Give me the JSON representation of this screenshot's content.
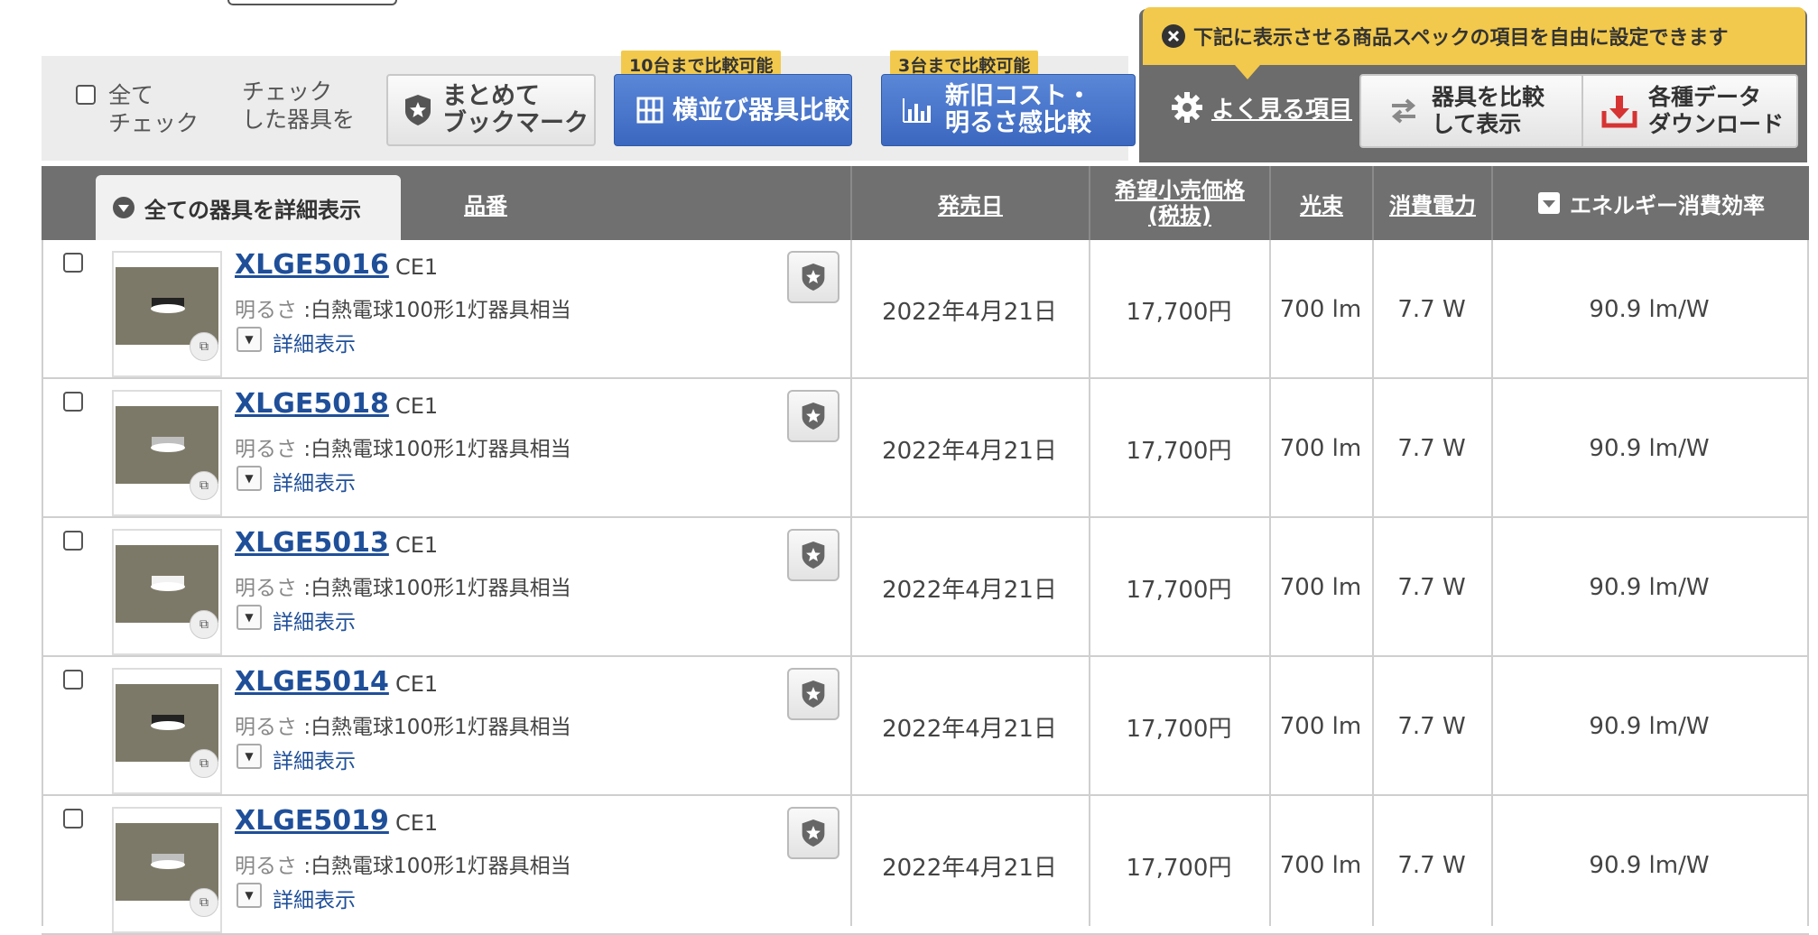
{
  "toolbar": {
    "check_all_label": "全て\nチェック",
    "checked_items_label": "チェック\nした器具を",
    "bookmark_all": "まとめて\nブックマーク",
    "compare_tag": "10台まで比較可能",
    "compare_side": "横並び器具比較",
    "cost_tag": "3台まで比較可能",
    "cost_compare": "新旧コスト・\n明るさ感比較"
  },
  "settings": {
    "banner_text": "下記に表示させる商品スペックの項目を自由に設定できます",
    "frequent_items": "よく見る項目",
    "compare_display": "器具を比較\nして表示",
    "download": "各種データ\nダウンロード"
  },
  "table": {
    "show_all_details": "全ての器具を詳細表示",
    "headers": {
      "part_no": "品番",
      "release": "発売日",
      "price": "希望小売価格\n(税抜)",
      "lumen": "光束",
      "power": "消費電力",
      "efficiency": "エネルギー消費効率"
    },
    "rows": [
      {
        "part": "XLGE5016",
        "model": "CE1",
        "brightness_label": "明るさ",
        "brightness": ":白熱電球100形1灯器具相当",
        "detail": "詳細表示",
        "date": "2022年4月21日",
        "price": "17,700円",
        "lumen": "700 lm",
        "power": "7.7 W",
        "eff": "90.9 lm/W",
        "cap": "#222222"
      },
      {
        "part": "XLGE5018",
        "model": "CE1",
        "brightness_label": "明るさ",
        "brightness": ":白熱電球100形1灯器具相当",
        "detail": "詳細表示",
        "date": "2022年4月21日",
        "price": "17,700円",
        "lumen": "700 lm",
        "power": "7.7 W",
        "eff": "90.9 lm/W",
        "cap": "#bfbfbf"
      },
      {
        "part": "XLGE5013",
        "model": "CE1",
        "brightness_label": "明るさ",
        "brightness": ":白熱電球100形1灯器具相当",
        "detail": "詳細表示",
        "date": "2022年4月21日",
        "price": "17,700円",
        "lumen": "700 lm",
        "power": "7.7 W",
        "eff": "90.9 lm/W",
        "cap": "#f2f2f2"
      },
      {
        "part": "XLGE5014",
        "model": "CE1",
        "brightness_label": "明るさ",
        "brightness": ":白熱電球100形1灯器具相当",
        "detail": "詳細表示",
        "date": "2022年4月21日",
        "price": "17,700円",
        "lumen": "700 lm",
        "power": "7.7 W",
        "eff": "90.9 lm/W",
        "cap": "#222222"
      },
      {
        "part": "XLGE5019",
        "model": "CE1",
        "brightness_label": "明るさ",
        "brightness": ":白熱電球100形1灯器具相当",
        "detail": "詳細表示",
        "date": "2022年4月21日",
        "price": "17,700円",
        "lumen": "700 lm",
        "power": "7.7 W",
        "eff": "90.9 lm/W",
        "cap": "#bfbfbf"
      }
    ]
  }
}
